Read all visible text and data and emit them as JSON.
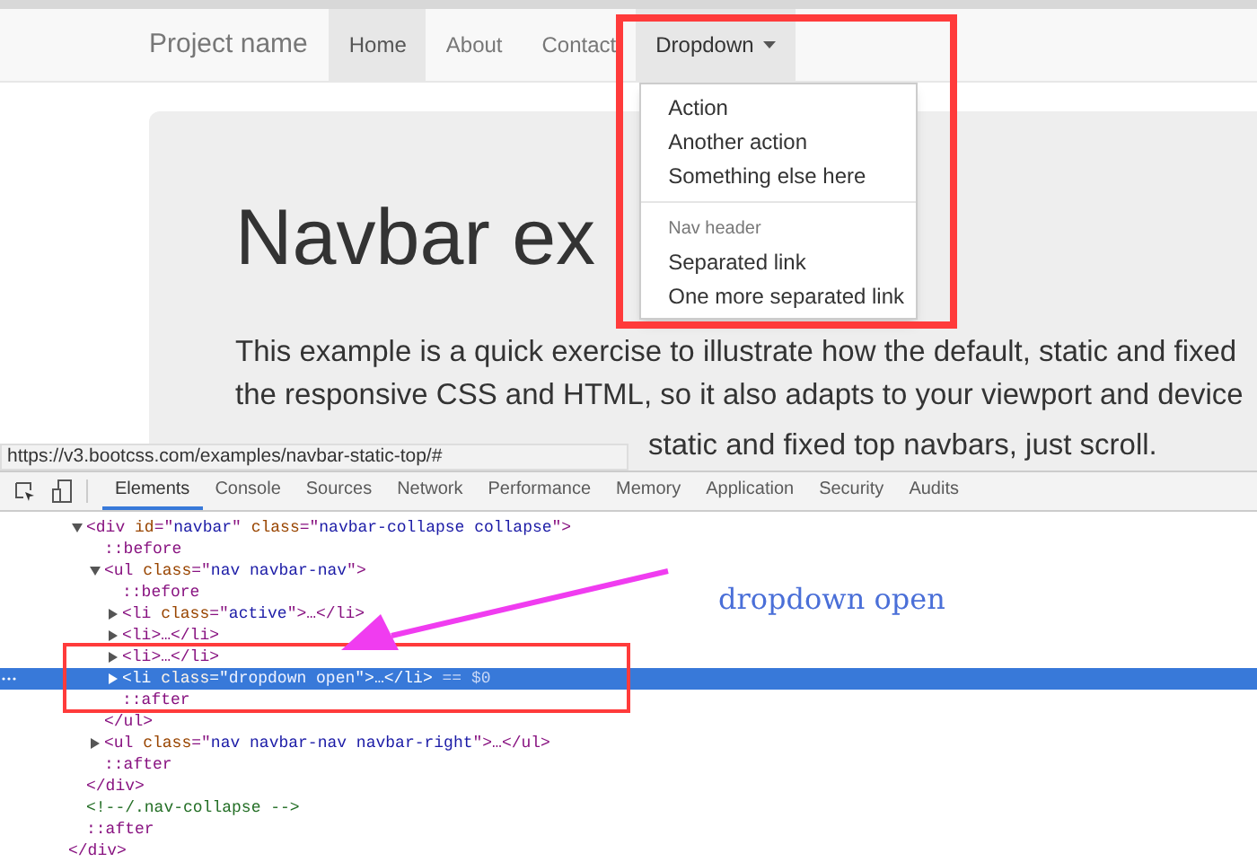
{
  "navbar": {
    "brand": "Project name",
    "items": [
      {
        "label": "Home",
        "selected": true,
        "kind": "link"
      },
      {
        "label": "About",
        "selected": false,
        "kind": "link"
      },
      {
        "label": "Contact",
        "selected": false,
        "kind": "link"
      },
      {
        "label": "Dropdown",
        "selected": false,
        "kind": "dropdown",
        "expanded": true
      }
    ]
  },
  "dropdown_menu": [
    {
      "kind": "item",
      "label": "Action"
    },
    {
      "kind": "item",
      "label": "Another action"
    },
    {
      "kind": "item",
      "label": "Something else here"
    },
    {
      "kind": "divider"
    },
    {
      "kind": "header",
      "label": "Nav header"
    },
    {
      "kind": "item",
      "label": "Separated link"
    },
    {
      "kind": "item",
      "label": "One more separated link"
    }
  ],
  "jumbotron": {
    "heading": "Navbar ex",
    "paragraphs": [
      "This example is a quick exercise to illustrate how the default, static and fixed",
      "the responsive CSS and HTML, so it also adapts to your viewport and device"
    ],
    "partial_line": "static and fixed top navbars, just scroll."
  },
  "status_url": "https://v3.bootcss.com/examples/navbar-static-top/#",
  "devtools": {
    "tabs": [
      {
        "label": "Elements",
        "selected": true
      },
      {
        "label": "Console",
        "selected": false
      },
      {
        "label": "Sources",
        "selected": false
      },
      {
        "label": "Network",
        "selected": false
      },
      {
        "label": "Performance",
        "selected": false
      },
      {
        "label": "Memory",
        "selected": false
      },
      {
        "label": "Application",
        "selected": false
      },
      {
        "label": "Security",
        "selected": false
      },
      {
        "label": "Audits",
        "selected": false
      }
    ],
    "dom_tree": {
      "nodes": [
        {
          "tokens": [
            {
              "kind": "tag",
              "s": "<div"
            },
            {
              "kind": "attr",
              "s": " id"
            },
            {
              "kind": "tag",
              "s": "=\""
            },
            {
              "kind": "value",
              "s": "navbar"
            },
            {
              "kind": "tag",
              "s": "\""
            },
            {
              "kind": "attr",
              "s": " class"
            },
            {
              "kind": "tag",
              "s": "=\""
            },
            {
              "kind": "value",
              "s": "navbar-collapse collapse"
            },
            {
              "kind": "tag",
              "s": "\">"
            }
          ],
          "expanded": true,
          "selected": false,
          "closing": [
            {
              "kind": "tag",
              "s": "</div>"
            }
          ],
          "children": [
            {
              "tokens": [
                {
                  "kind": "pseudo",
                  "s": "::before"
                }
              ],
              "selected": false
            },
            {
              "tokens": [
                {
                  "kind": "tag",
                  "s": "<ul"
                },
                {
                  "kind": "attr",
                  "s": " class"
                },
                {
                  "kind": "tag",
                  "s": "=\""
                },
                {
                  "kind": "value",
                  "s": "nav navbar-nav"
                },
                {
                  "kind": "tag",
                  "s": "\">"
                }
              ],
              "expanded": true,
              "selected": false,
              "closing": [
                {
                  "kind": "tag",
                  "s": "</ul>"
                }
              ],
              "children": [
                {
                  "tokens": [
                    {
                      "kind": "pseudo",
                      "s": "::before"
                    }
                  ],
                  "selected": false
                },
                {
                  "tokens": [
                    {
                      "kind": "tag",
                      "s": "<li"
                    },
                    {
                      "kind": "attr",
                      "s": " class"
                    },
                    {
                      "kind": "tag",
                      "s": "=\""
                    },
                    {
                      "kind": "value",
                      "s": "active"
                    },
                    {
                      "kind": "tag",
                      "s": "\">…</li>"
                    }
                  ],
                  "expanded": false,
                  "selected": false
                },
                {
                  "tokens": [
                    {
                      "kind": "tag",
                      "s": "<li>…</li>"
                    }
                  ],
                  "expanded": false,
                  "selected": false
                },
                {
                  "tokens": [
                    {
                      "kind": "tag",
                      "s": "<li>…</li>"
                    }
                  ],
                  "expanded": false,
                  "selected": false
                },
                {
                  "tokens": [
                    {
                      "kind": "tag",
                      "s": "<li"
                    },
                    {
                      "kind": "attr",
                      "s": " class"
                    },
                    {
                      "kind": "tag",
                      "s": "=\""
                    },
                    {
                      "kind": "value",
                      "s": "dropdown open"
                    },
                    {
                      "kind": "tag",
                      "s": "\">…</li>"
                    },
                    {
                      "kind": "marker",
                      "s": " == $0"
                    }
                  ],
                  "expanded": false,
                  "selected": true
                },
                {
                  "tokens": [
                    {
                      "kind": "pseudo",
                      "s": "::after"
                    }
                  ],
                  "selected": false
                }
              ]
            },
            {
              "tokens": [
                {
                  "kind": "tag",
                  "s": "<ul"
                },
                {
                  "kind": "attr",
                  "s": " class"
                },
                {
                  "kind": "tag",
                  "s": "=\""
                },
                {
                  "kind": "value",
                  "s": "nav navbar-nav navbar-right"
                },
                {
                  "kind": "tag",
                  "s": "\">…</ul>"
                }
              ],
              "expanded": false,
              "selected": false
            },
            {
              "tokens": [
                {
                  "kind": "pseudo",
                  "s": "::after"
                }
              ],
              "selected": false
            }
          ]
        },
        {
          "tokens": [
            {
              "kind": "comment",
              "s": "<!--/.nav-collapse -->"
            }
          ],
          "selected": false
        },
        {
          "tokens": [
            {
              "kind": "pseudo",
              "s": "::after"
            }
          ],
          "selected": false
        }
      ],
      "closing": [
        {
          "kind": "tag",
          "s": "</div>"
        }
      ]
    }
  },
  "annotation": {
    "label": "dropdown open"
  }
}
